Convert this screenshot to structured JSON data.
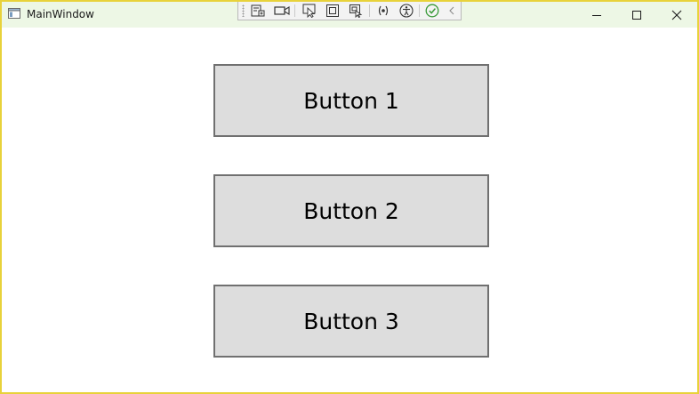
{
  "window": {
    "title": "MainWindow"
  },
  "debug_toolbar": {
    "tools": [
      "live-visual-tree-icon",
      "record-icon",
      "select-element-icon",
      "display-layout-adorners-icon",
      "track-focused-element-icon",
      "binding-failures-icon",
      "accessibility-checker-icon",
      "checkmark-icon",
      "collapse-chevron-icon"
    ]
  },
  "main": {
    "buttons": [
      {
        "label": "Button 1"
      },
      {
        "label": "Button 2"
      },
      {
        "label": "Button 3"
      }
    ]
  },
  "colors": {
    "window_border": "#e8d23a",
    "titlebar_bg": "#edf7e5",
    "button_bg": "#dddddd",
    "button_border": "#707070",
    "check_green": "#3a9a3a"
  }
}
